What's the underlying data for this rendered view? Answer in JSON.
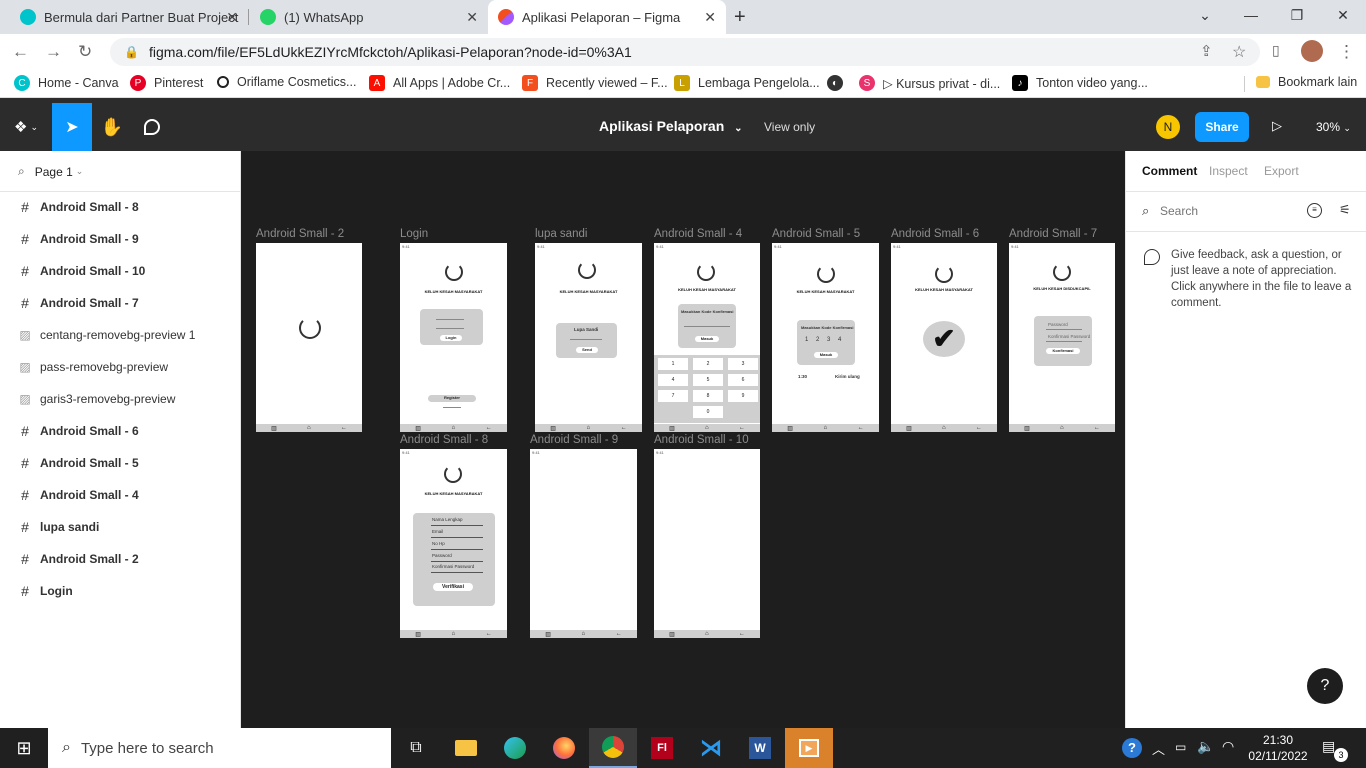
{
  "browser": {
    "tabs": [
      {
        "title": "Bermula dari Partner Buat Project",
        "icon": "canva-icon",
        "color": "#00c4cc"
      },
      {
        "title": "(1) WhatsApp",
        "icon": "whatsapp-icon",
        "color": "#25d366"
      },
      {
        "title": "Aplikasi Pelaporan – Figma",
        "icon": "figma-icon",
        "color": "#f24e1e"
      }
    ],
    "new_tab": "+",
    "url": "figma.com/file/EF5LdUkkEZIYrcMfckctoh/Aplikasi-Pelaporan?node-id=0%3A1",
    "bookmarks": [
      {
        "label": "Home - Canva",
        "color": "#00c4cc",
        "glyph": "C"
      },
      {
        "label": "Pinterest",
        "color": "#e60023",
        "glyph": "P"
      },
      {
        "label": "Oriflame Cosmetics...",
        "color": "#222222",
        "glyph": "O"
      },
      {
        "label": "All Apps | Adobe Cr...",
        "color": "#fa0f00",
        "glyph": "A"
      },
      {
        "label": "Recently viewed – F...",
        "color": "#f24e1e",
        "glyph": "F"
      },
      {
        "label": "Lembaga Pengelola...",
        "color": "#c8a000",
        "glyph": "L"
      },
      {
        "label": "",
        "color": "#333333",
        "glyph": "◐"
      },
      {
        "label": "▷ Kursus privat - di...",
        "color": "#e8336d",
        "glyph": "S"
      },
      {
        "label": "Tonton video yang...",
        "color": "#000000",
        "glyph": "♪"
      }
    ],
    "bookmark_other": "Bookmark lain"
  },
  "figma": {
    "file_name": "Aplikasi Pelaporan",
    "view_mode": "View only",
    "avatar_initial": "N",
    "share_label": "Share",
    "zoom": "30%",
    "page": "Page 1",
    "layers": [
      {
        "name": "Android Small - 8",
        "type": "frame"
      },
      {
        "name": "Android Small - 9",
        "type": "frame"
      },
      {
        "name": "Android Small - 10",
        "type": "frame"
      },
      {
        "name": "Android Small - 7",
        "type": "frame"
      },
      {
        "name": "centang-removebg-preview 1",
        "type": "image"
      },
      {
        "name": "pass-removebg-preview",
        "type": "image"
      },
      {
        "name": "garis3-removebg-preview",
        "type": "image"
      },
      {
        "name": "Android Small - 6",
        "type": "frame"
      },
      {
        "name": "Android Small - 5",
        "type": "frame"
      },
      {
        "name": "Android Small - 4",
        "type": "frame"
      },
      {
        "name": "lupa sandi",
        "type": "frame"
      },
      {
        "name": "Android Small - 2",
        "type": "frame"
      },
      {
        "name": "Login",
        "type": "frame"
      }
    ],
    "right_tabs": [
      "Comment",
      "Inspect",
      "Export"
    ],
    "search_placeholder": "Search",
    "comment_hint": "Give feedback, ask a question, or just leave a note of appreciation. Click anywhere in the file to leave a comment.",
    "help": "?",
    "frames": {
      "f2": "Android Small - 2",
      "login": "Login",
      "lupa": "lupa sandi",
      "f4": "Android Small - 4",
      "f5": "Android Small - 5",
      "f6": "Android Small - 6",
      "f7": "Android Small - 7",
      "f8": "Android Small - 8",
      "f9": "Android Small - 9",
      "f10": "Android Small - 10"
    },
    "mock": {
      "app_title": "KELUH KESAH MASYARAKAT",
      "app_title_f7": "KELUH KESAH DISDUKCAPIL",
      "login_btn": "Login",
      "register_btn": "Register",
      "lupa_title": "Lupa Sandi",
      "send_btn": "Send",
      "code_title": "Masukkan Kode Konfirmasi",
      "masuk_btn": "Masuk",
      "code_digits": "1 2 3 4",
      "timer": "1:30",
      "resend": "Kirim ulang",
      "keypad": [
        "1",
        "2",
        "3",
        "4",
        "5",
        "6",
        "7",
        "8",
        "9",
        "0"
      ],
      "password": "Password",
      "confirm_password": "Konfirmasi Password",
      "confirm_btn": "Konfirmasi",
      "register_fields": [
        "Nama Lengkap",
        "Email",
        "No Hp",
        "Password",
        "Konfirmasi Password"
      ],
      "verify_btn": "Verifikasi"
    }
  },
  "taskbar": {
    "search_placeholder": "Type here to search",
    "time": "21:30",
    "date": "02/11/2022",
    "notifications": "3"
  }
}
